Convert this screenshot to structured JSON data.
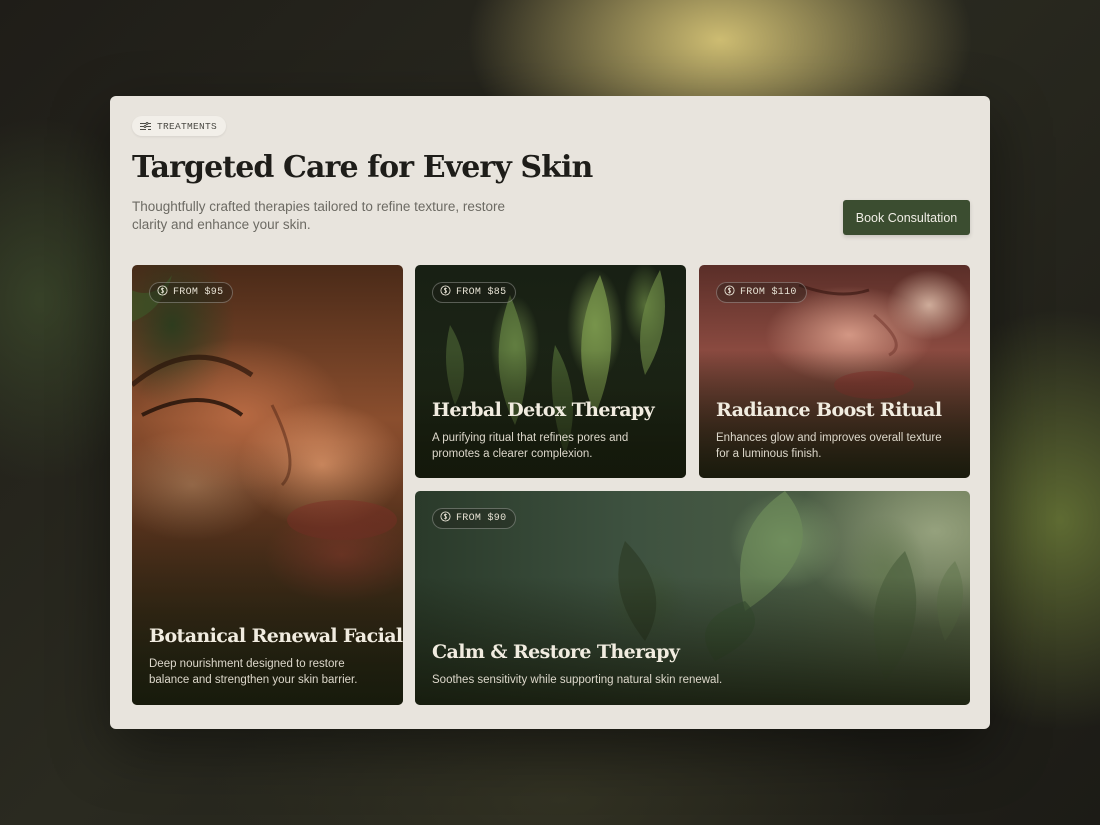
{
  "section": {
    "tag_label": "TREATMENTS",
    "title": "Targeted Care for Every Skin",
    "subtitle": "Thoughtfully crafted therapies tailored to refine texture, restore clarity and enhance your skin.",
    "cta_label": "Book Consultation"
  },
  "cards": [
    {
      "price": "FROM $95",
      "title": "Botanical Renewal Facial",
      "description": "Deep nourishment designed to restore balance and strengthen your skin barrier."
    },
    {
      "price": "FROM $85",
      "title": "Herbal Detox Therapy",
      "description": "A purifying ritual that refines pores and promotes a clearer complexion."
    },
    {
      "price": "FROM $110",
      "title": "Radiance Boost Ritual",
      "description": "Enhances glow and improves overall texture for a luminous finish."
    },
    {
      "price": "FROM $90",
      "title": "Calm & Restore Therapy",
      "description": "Soothes sensitivity while supporting natural skin renewal."
    }
  ],
  "icons": {
    "tag": "sliders-icon",
    "price": "dollar-circle-icon"
  },
  "colors": {
    "accent": "#3b4d30",
    "panel": "#e8e4dd"
  }
}
